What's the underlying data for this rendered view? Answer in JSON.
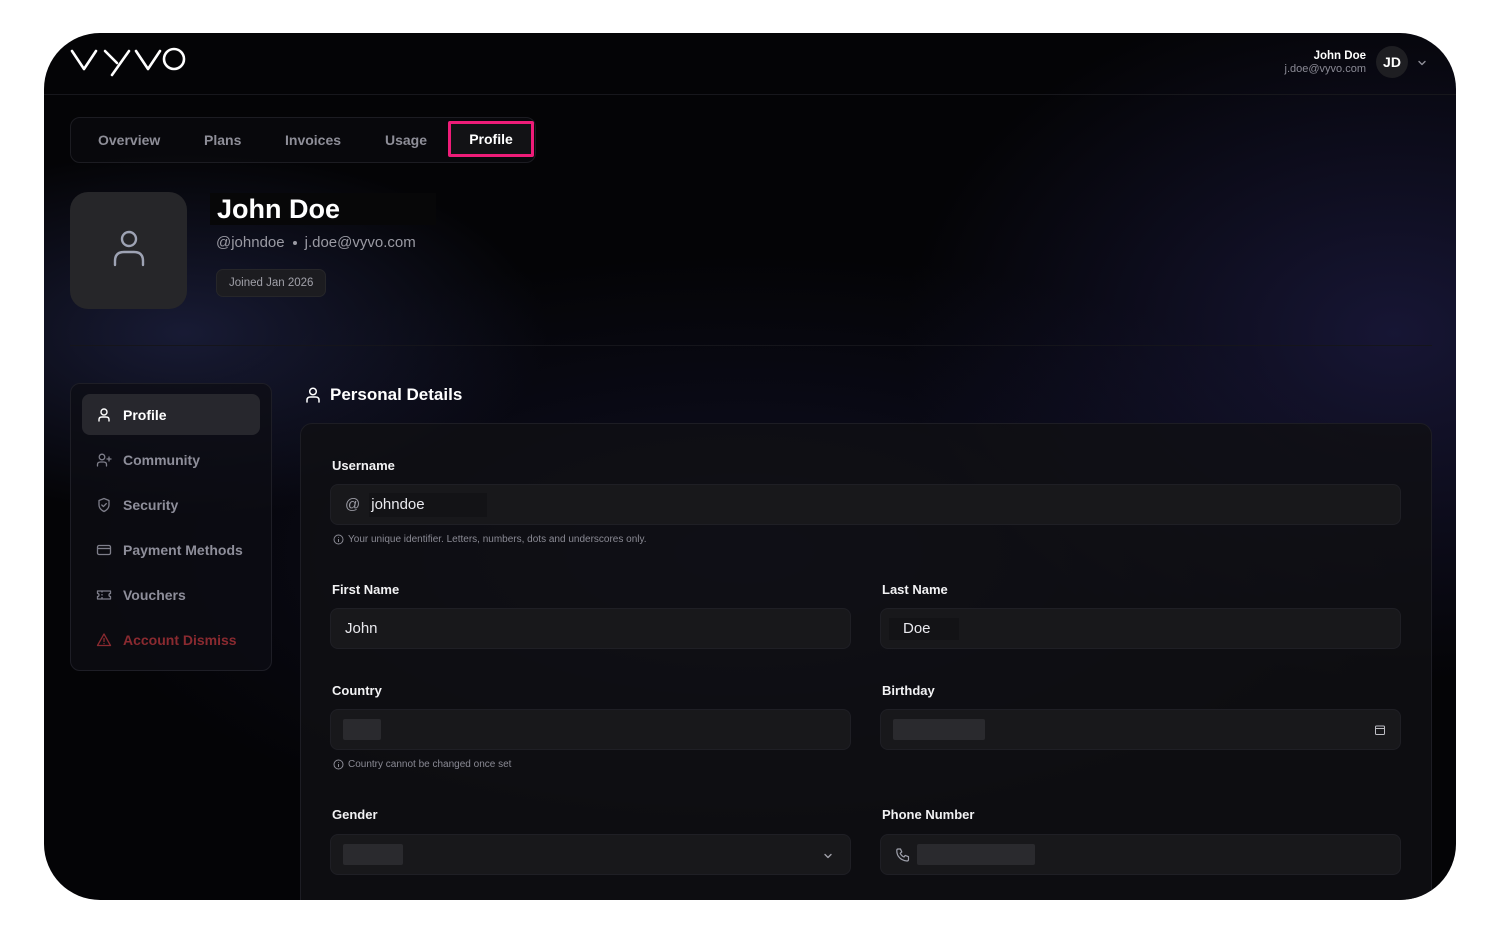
{
  "header": {
    "logo_text": "vyvo",
    "user_name": "John Doe",
    "user_email": "j.doe@vyvo.com",
    "user_initials": "JD"
  },
  "tabs": [
    {
      "label": "Overview"
    },
    {
      "label": "Plans"
    },
    {
      "label": "Invoices"
    },
    {
      "label": "Usage"
    },
    {
      "label": "Profile",
      "active": true
    }
  ],
  "profile": {
    "name": "John Doe",
    "handle": "@johndoe",
    "email": "j.doe@vyvo.com",
    "joined": "Joined Jan 2026"
  },
  "side_menu": [
    {
      "label": "Profile",
      "icon": "user-icon",
      "active": true
    },
    {
      "label": "Community",
      "icon": "user-plus-icon"
    },
    {
      "label": "Security",
      "icon": "shield-icon"
    },
    {
      "label": "Payment Methods",
      "icon": "credit-card-icon"
    },
    {
      "label": "Vouchers",
      "icon": "ticket-icon"
    },
    {
      "label": "Account Dismiss",
      "icon": "warning-icon",
      "danger": true
    }
  ],
  "section": {
    "title": "Personal Details"
  },
  "form": {
    "username": {
      "label": "Username",
      "prefix": "@",
      "value": "johndoe",
      "hint": "Your unique identifier. Letters, numbers, dots and underscores only."
    },
    "first_name": {
      "label": "First Name",
      "value": "John"
    },
    "last_name": {
      "label": "Last Name",
      "value": "Doe"
    },
    "country": {
      "label": "Country",
      "hint": "Country cannot be changed once set"
    },
    "birthday": {
      "label": "Birthday"
    },
    "gender": {
      "label": "Gender"
    },
    "phone": {
      "label": "Phone Number"
    }
  },
  "colors": {
    "accent_highlight": "#ee1c78",
    "danger": "#8a2a30",
    "background": "#040406"
  }
}
